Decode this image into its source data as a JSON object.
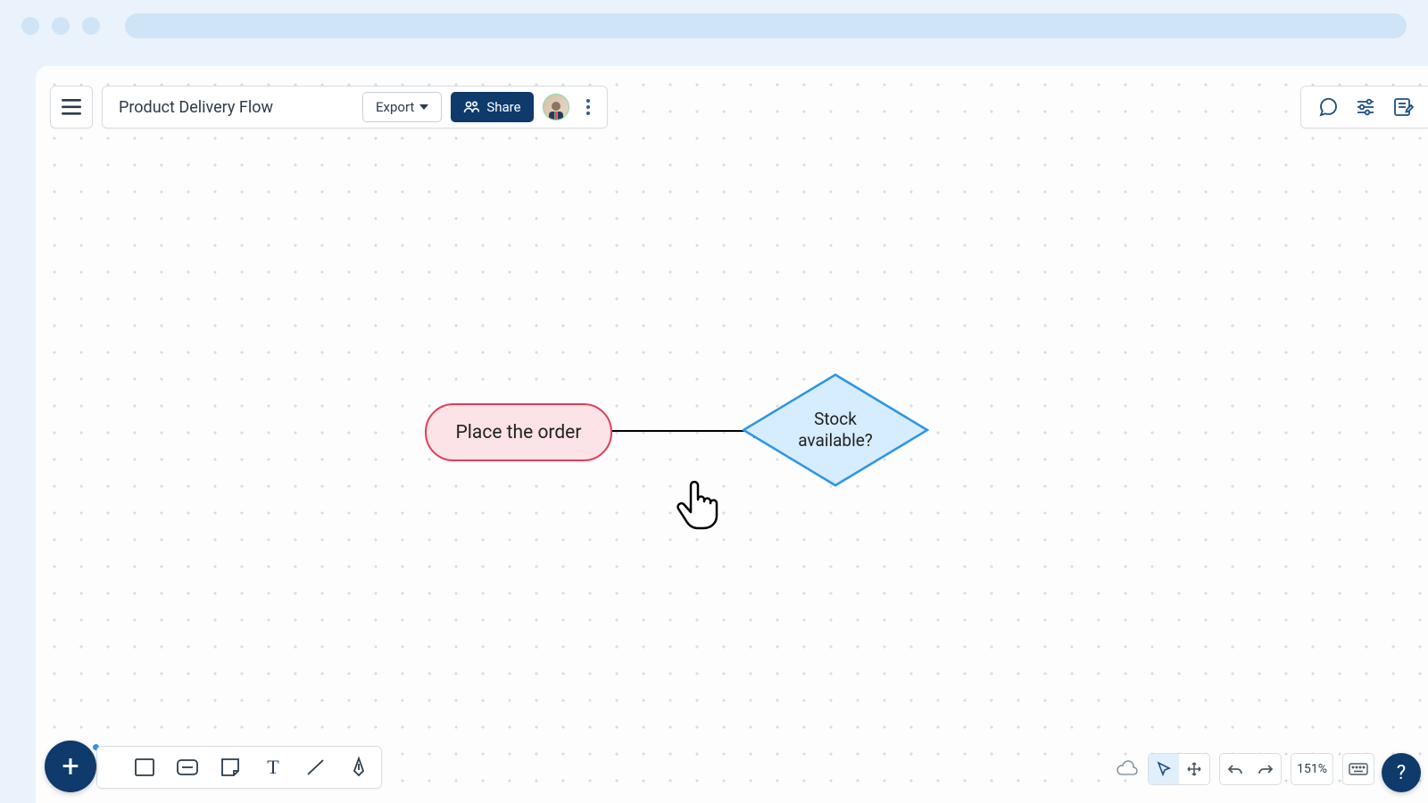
{
  "document": {
    "title": "Product Delivery Flow"
  },
  "toolbar": {
    "export_label": "Export",
    "share_label": "Share"
  },
  "nodes": {
    "place_order": "Place the order",
    "stock_check": "Stock\navailable?"
  },
  "controls": {
    "zoom": "151%",
    "help": "?"
  },
  "fab": {
    "plus": "+"
  }
}
